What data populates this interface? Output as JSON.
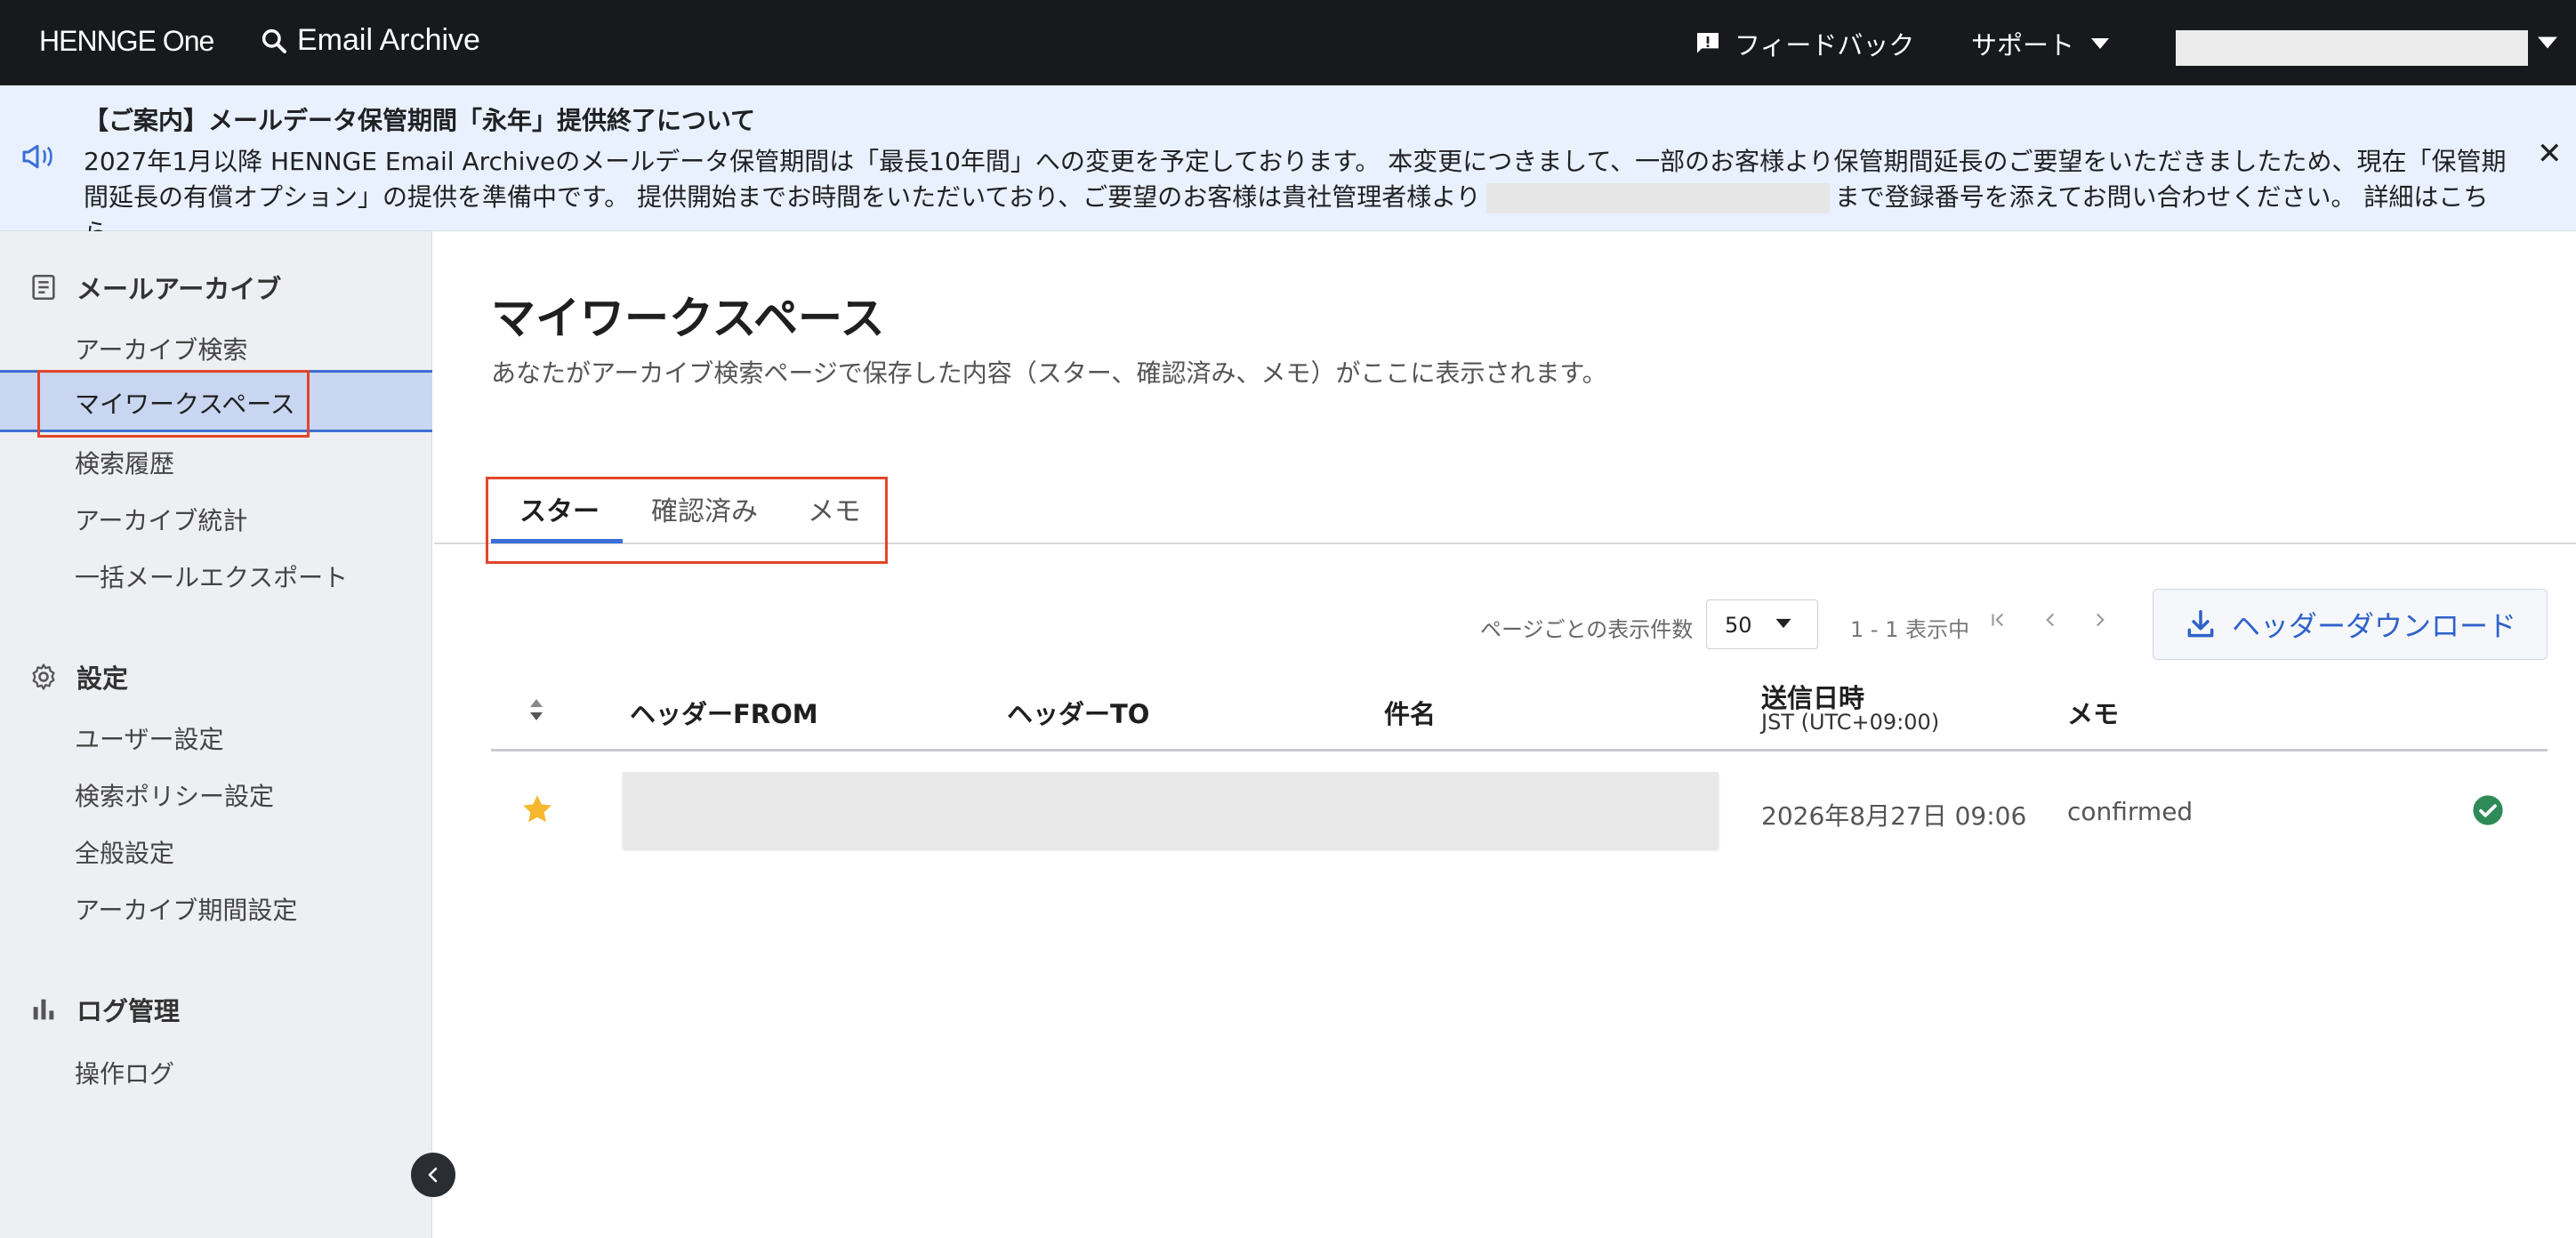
{
  "topbar": {
    "logo": "HENNGE One",
    "app_title": "Email Archive",
    "feedback_label": "フィードバック",
    "support_label": "サポート"
  },
  "announcement": {
    "title": "【ご案内】メールデータ保管期間「永年」提供終了について",
    "body_part1": "2027年1月以降 HENNGE Email Archiveのメールデータ保管期間は「最長10年間」への変更を予定しております。 本変更につきまして、一部のお客様より保管期間延長のご要望をいただきましたため、現在「保管期間延長の有償オプション」の提供を準備中です。 提供開始までお時間をいただいており、ご要望のお客様は貴社管理者様より",
    "body_part2": "まで登録番号を添えてお問い合わせください。 詳細はこちら"
  },
  "sidebar": {
    "groups": [
      {
        "title": "メールアーカイブ",
        "icon": "archive-icon",
        "items": [
          "アーカイブ検索",
          "マイワークスペース",
          "検索履歴",
          "アーカイブ統計",
          "一括メールエクスポート"
        ]
      },
      {
        "title": "設定",
        "icon": "gear-icon",
        "items": [
          "ユーザー設定",
          "検索ポリシー設定",
          "全般設定",
          "アーカイブ期間設定"
        ]
      },
      {
        "title": "ログ管理",
        "icon": "bar-chart-icon",
        "items": [
          "操作ログ"
        ]
      }
    ],
    "active_item": "マイワークスペース"
  },
  "main": {
    "title": "マイワークスペース",
    "description": "あなたがアーカイブ検索ページで保存した内容（スター、確認済み、メモ）がここに表示されます。",
    "tabs": [
      "スター",
      "確認済み",
      "メモ"
    ],
    "active_tab": "スター",
    "pager": {
      "label": "ページごとの表示件数",
      "page_size": "50",
      "range": "1 - 1 表示中"
    },
    "download_label": "ヘッダーダウンロード",
    "table": {
      "headers": {
        "from": "ヘッダーFROM",
        "to": "ヘッダーTO",
        "subject": "件名",
        "sent": "送信日時",
        "sent_tz": "JST (UTC+09:00)",
        "memo": "メモ"
      },
      "rows": [
        {
          "starred": true,
          "sent": "2026年8月27日 09:06",
          "memo": "confirmed",
          "confirmed": true
        }
      ]
    }
  },
  "colors": {
    "topbar": "#17191d",
    "accent": "#3b6ed8",
    "highlight_outline": "#e2452b",
    "star": "#f5b82e",
    "check": "#2e8b57"
  }
}
